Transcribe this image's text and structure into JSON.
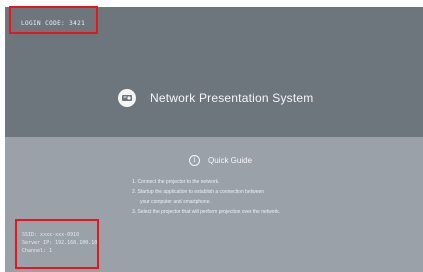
{
  "header": {
    "login_code": "LOGIN CODE: 3421"
  },
  "brand": {
    "icon": "projector-logo-icon",
    "title": "Network Presentation System"
  },
  "quick_guide": {
    "icon": "info-icon",
    "icon_glyph": "i",
    "title": "Quick Guide",
    "steps": [
      "1. Connect the projector to the network.",
      "2. Startup the application to establish a connection between",
      "your computer and smartphone.",
      "3. Select the projector that will perform projection over the network."
    ]
  },
  "network_info": {
    "ssid": "SSID: xxxx-xxx-0910",
    "server_ip": "Server IP: 192.168.100.10",
    "channel": "Channel: 1"
  },
  "colors": {
    "highlight": "#e8161b",
    "top_panel": "#6d767d",
    "bottom_panel": "#9aa1a8"
  }
}
